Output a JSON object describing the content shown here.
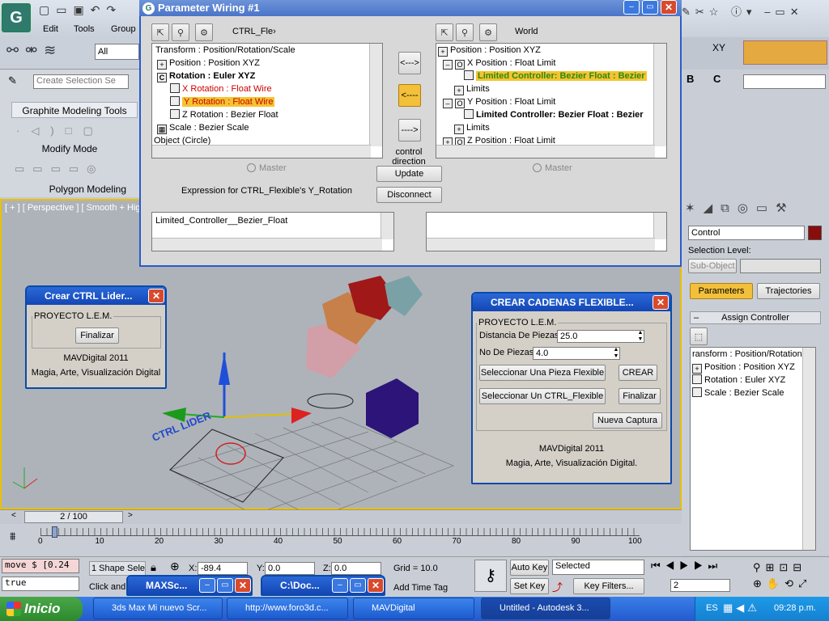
{
  "menu": {
    "edit": "Edit",
    "tools": "Tools",
    "group": "Group"
  },
  "toolbar": {
    "selection_filter": "All",
    "create_selection_set": "Create Selection Se",
    "xy": "XY"
  },
  "graphite": {
    "title": "Graphite Modeling Tools",
    "modify_mode": "Modify Mode",
    "polygon_modeling": "Polygon Modeling"
  },
  "viewport": {
    "label": "[ + ] [ Perspective ] [ Smooth + Hig",
    "ctrl_label": "CTRL LIDER"
  },
  "param": {
    "title": "Parameter Wiring #1",
    "left_name": "CTRL_Fle›",
    "right_name": "World",
    "left_tree": [
      "Transform : Position/Rotation/Scale",
      "Position : Position XYZ",
      "Rotation : Euler XYZ",
      "X Rotation : Float Wire",
      "Y Rotation : Float Wire",
      "Z Rotation : Bezier Float",
      "Scale : Bezier Scale",
      "Object (Circle)"
    ],
    "right_tree": [
      "Position : Position XYZ",
      "X Position : Float Limit",
      "Limited Controller: Bezier Float : Bezier",
      "Limits",
      "Y Position : Float Limit",
      "Limited Controller: Bezier Float : Bezier",
      "Limits",
      "Z Position : Float Limit"
    ],
    "arrow_both": "<--->",
    "arrow_left": "<----",
    "arrow_right": "---->",
    "control_direction": "control\ndirection",
    "master": "Master",
    "update": "Update",
    "disconnect": "Disconnect",
    "expression_label": "Expression for CTRL_Flexible's Y_Rotation",
    "expression": "Limited_Controller__Bezier_Float"
  },
  "crear_ctrl": {
    "title": "Crear CTRL Lider...",
    "group": "PROYECTO L.E.M.",
    "finalizar": "Finalizar",
    "credit1": "MAVDigital 2011",
    "credit2": "Magia, Arte, Visualización Digital"
  },
  "cadenas": {
    "title": "CREAR CADENAS FLEXIBLE...",
    "group": "PROYECTO L.E.M.",
    "dist_label": "Distancia De Piezas",
    "dist_value": "25.0",
    "no_label": "No De Piezas",
    "no_value": "4.0",
    "sel_pieza": "Seleccionar Una Pieza Flexible",
    "crear": "CREAR",
    "sel_ctrl": "Seleccionar Un CTRL_Flexible",
    "finalizar": "Finalizar",
    "nueva": "Nueva Captura",
    "credit1": "MAVDigital 2011",
    "credit2": "Magia, Arte, Visualización Digital."
  },
  "cmdpanel": {
    "name": "Control",
    "selection_level": "Selection Level:",
    "sub_object": "Sub-Object",
    "tab_parameters": "Parameters",
    "tab_trajectories": "Trajectories",
    "rollout": "Assign Controller",
    "tree": [
      "ransform : Position/Rotation",
      "Position : Position XYZ",
      "Rotation : Euler XYZ",
      "Scale : Bezier Scale"
    ]
  },
  "timeline": {
    "frame": "2 / 100",
    "ticks": [
      "0",
      "10",
      "20",
      "30",
      "40",
      "50",
      "60",
      "70",
      "80",
      "90",
      "100"
    ]
  },
  "status": {
    "listener1": "move $ [0.24",
    "listener2": "true",
    "shape_sel": "1 Shape Selec",
    "click_and": "Click and",
    "x_label": "X:",
    "x": "-89.4",
    "y_label": "Y:",
    "y": "0.0",
    "z_label": "Z:",
    "z": "0.0",
    "grid": "Grid = 10.0",
    "add_time_tag": "Add Time Tag",
    "auto_key": "Auto Key",
    "set_key": "Set Key",
    "selected": "Selected",
    "key_filters": "Key Filters...",
    "frame_field": "2"
  },
  "mini_windows": {
    "max": "MAXSc...",
    "doc": "C:\\Doc..."
  },
  "taskbar": {
    "start": "Inicio",
    "items": [
      "3ds Max Mi nuevo Scr...",
      "http://www.foro3d.c...",
      "MAVDigital",
      "Untitled - Autodesk 3..."
    ],
    "lang": "ES",
    "clock": "09:28 p.m."
  }
}
